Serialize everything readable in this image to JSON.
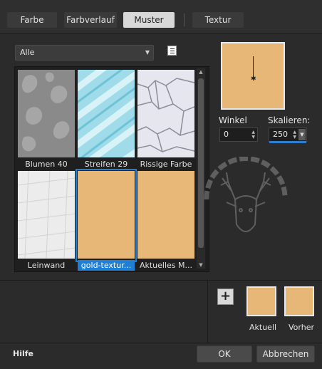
{
  "tabs": [
    {
      "label": "Farbe"
    },
    {
      "label": "Farbverlauf"
    },
    {
      "label": "Muster"
    },
    {
      "label": "Textur"
    }
  ],
  "category_dropdown": {
    "selected": "Alle"
  },
  "patterns": [
    {
      "caption": "Blumen 40"
    },
    {
      "caption": "Streifen 29"
    },
    {
      "caption": "Rissige Farbe"
    },
    {
      "caption": "Leinwand"
    },
    {
      "caption": "gold-textur..."
    },
    {
      "caption": "Aktuelles M..."
    }
  ],
  "angle": {
    "label": "Winkel",
    "value": "0"
  },
  "scale": {
    "label": "Skalieren:",
    "value": "250"
  },
  "swatches": {
    "current_label": "Aktuell",
    "previous_label": "Vorher"
  },
  "footer": {
    "help": "Hilfe",
    "ok": "OK",
    "cancel": "Abbrechen"
  },
  "colors": {
    "accent": "#1e7fd6",
    "gold": "#e6b777",
    "background": "#2b2b2b"
  }
}
